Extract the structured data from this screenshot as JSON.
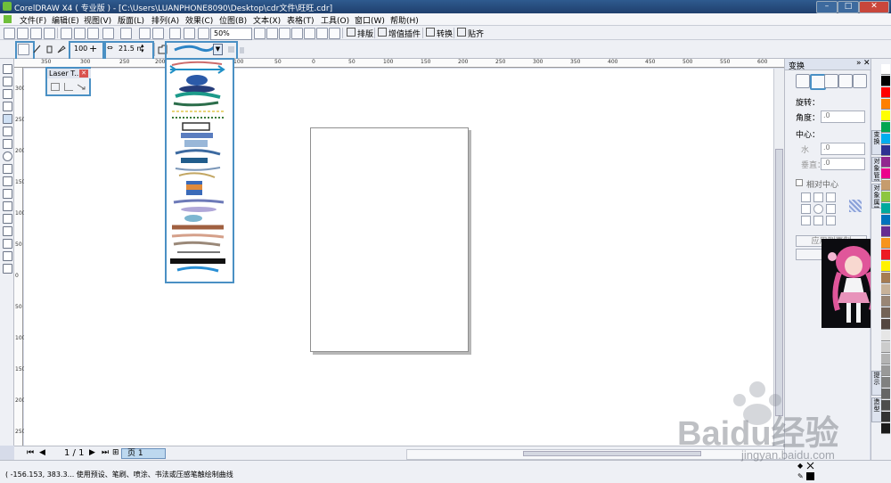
{
  "window": {
    "title": "CorelDRAW X4 ( 专业版 ) - [C:\\Users\\LUANPHONE8090\\Desktop\\cdr文件\\旺旺.cdr]",
    "controls": [
      "–",
      "□",
      "✕"
    ]
  },
  "menu": [
    "文件(F)",
    "编辑(E)",
    "视图(V)",
    "版面(L)",
    "排列(A)",
    "效果(C)",
    "位图(B)",
    "文本(X)",
    "表格(T)",
    "工具(O)",
    "窗口(W)",
    "帮助(H)"
  ],
  "std_toolbar": {
    "zoom": "50%",
    "buttons": [
      "排版",
      "增值插件",
      "转换",
      "贴齐"
    ]
  },
  "property_bar": {
    "smoothing": "100",
    "width": "21.5 mm"
  },
  "rulers": {
    "h_ticks": [
      "350",
      "300",
      "250",
      "200",
      "150",
      "100",
      "50",
      "0",
      "50",
      "100",
      "150",
      "200",
      "250",
      "300",
      "350",
      "400",
      "450",
      "500",
      "550",
      "600"
    ],
    "v_ticks": [
      "300",
      "250",
      "200",
      "150",
      "100",
      "50",
      "0",
      "50",
      "100",
      "150",
      "200",
      "250"
    ],
    "unit": "毫米"
  },
  "laser_panel": {
    "title": "Laser T...",
    "close": "✕"
  },
  "navigation": {
    "page_counter": "1 / 1",
    "page_tab": "页 1"
  },
  "status": {
    "text": "( -156.153, 383.3... 使用预设、笔刷、喷涂、书法或压感笔触绘制曲线"
  },
  "docker": {
    "title": "变换",
    "rotation_label": "旋转：",
    "angle_label": "角度：",
    "angle_value": ".0",
    "center_label": "中心：",
    "h_label": "水",
    "h_value": ".0",
    "v_label": "垂直：",
    "v_value": ".0",
    "relative_center": "相对中心",
    "apply_button": "应用到再制",
    "tabs": [
      "变换",
      "对象管理器",
      "对象属性",
      "提示",
      "造型"
    ]
  },
  "watermark": {
    "brand": "Baidu经验",
    "url": "jingyan.baidu.com"
  },
  "colors": {
    "highlight": "#4a90c4",
    "titlebar": "#1f3f6d",
    "palette": [
      "#ffffff",
      "#000000",
      "#ff0000",
      "#ff7f00",
      "#ffff00",
      "#00a651",
      "#00aeef",
      "#2e3192",
      "#92278f",
      "#ec008c",
      "#c69c6d",
      "#8dc63f",
      "#00a99d",
      "#0072bc",
      "#662d91",
      "#f7941d",
      "#ed1c24",
      "#fff200",
      "#a67c52",
      "#c7b299",
      "#998675",
      "#736357",
      "#534741",
      "#e6e6e6",
      "#cccccc",
      "#b3b3b3",
      "#999999",
      "#808080",
      "#666666",
      "#4d4d4d",
      "#333333",
      "#1a1a1a"
    ]
  }
}
